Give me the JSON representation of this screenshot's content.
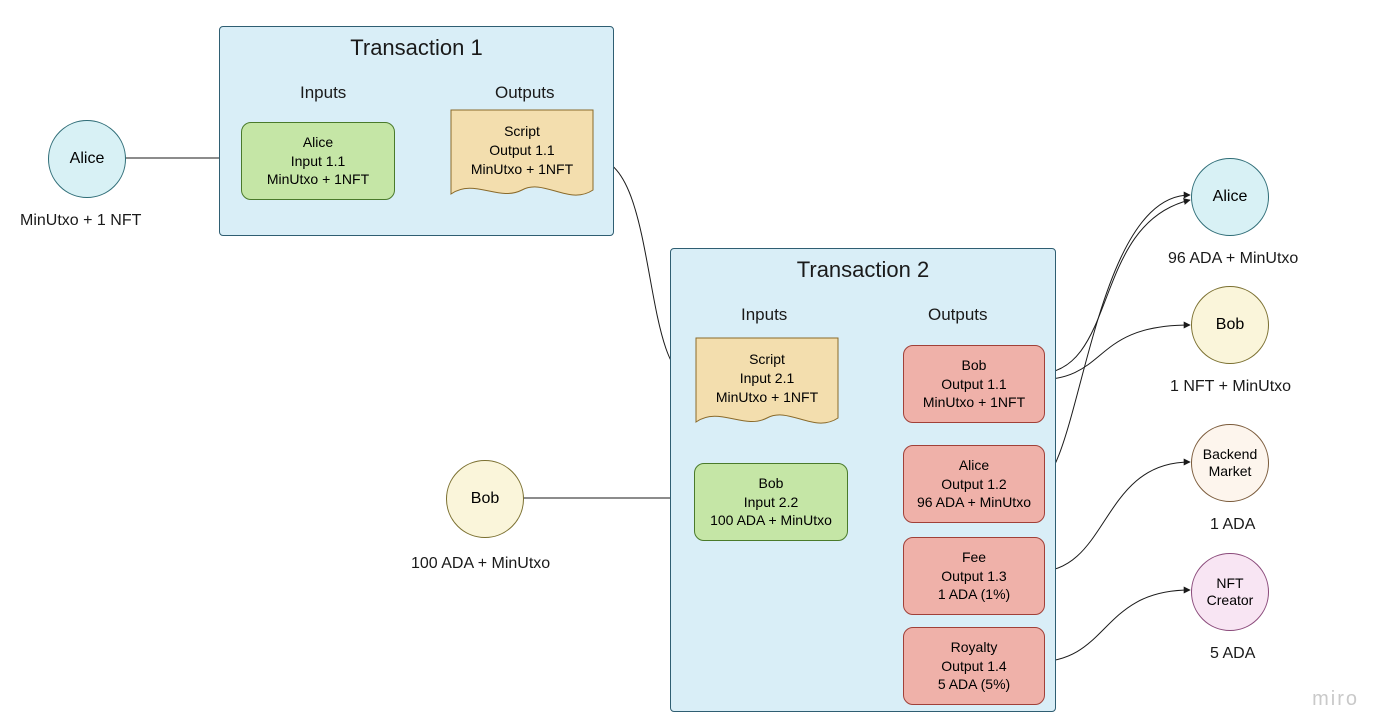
{
  "tx1": {
    "title": "Transaction 1",
    "inputs_label": "Inputs",
    "outputs_label": "Outputs",
    "input": {
      "owner": "Alice",
      "name": "Input 1.1",
      "value": "MinUtxo + 1NFT"
    },
    "output": {
      "owner": "Script",
      "name": "Output 1.1",
      "value": "MinUtxo + 1NFT"
    }
  },
  "tx2": {
    "title": "Transaction 2",
    "inputs_label": "Inputs",
    "outputs_label": "Outputs",
    "script_input": {
      "owner": "Script",
      "name": "Input 2.1",
      "value": "MinUtxo + 1NFT"
    },
    "bob_input": {
      "owner": "Bob",
      "name": "Input 2.2",
      "value": "100 ADA + MinUtxo"
    },
    "out_bob": {
      "owner": "Bob",
      "name": "Output 1.1",
      "value": "MinUtxo + 1NFT"
    },
    "out_alice": {
      "owner": "Alice",
      "name": "Output 1.2",
      "value": "96 ADA + MinUtxo"
    },
    "out_fee": {
      "owner": "Fee",
      "name": "Output 1.3",
      "value": "1 ADA (1%)"
    },
    "out_royalty": {
      "owner": "Royalty",
      "name": "Output 1.4",
      "value": "5 ADA (5%)"
    }
  },
  "actors": {
    "alice_in": {
      "label": "Alice",
      "caption": "MinUtxo + 1 NFT"
    },
    "bob_in": {
      "label": "Bob",
      "caption": "100 ADA + MinUtxo"
    },
    "alice_out": {
      "label": "Alice",
      "caption": "96 ADA + MinUtxo"
    },
    "bob_out": {
      "label": "Bob",
      "caption": "1 NFT + MinUtxo"
    },
    "market": {
      "label": "Backend Market",
      "caption": "1 ADA"
    },
    "creator": {
      "label": "NFT Creator",
      "caption": "5 ADA"
    }
  },
  "watermark": "miro",
  "colors": {
    "tx_bg": "#d9eef7",
    "green": "#c5e6a6",
    "yellow": "#f3deae",
    "red": "#efb1a9"
  }
}
